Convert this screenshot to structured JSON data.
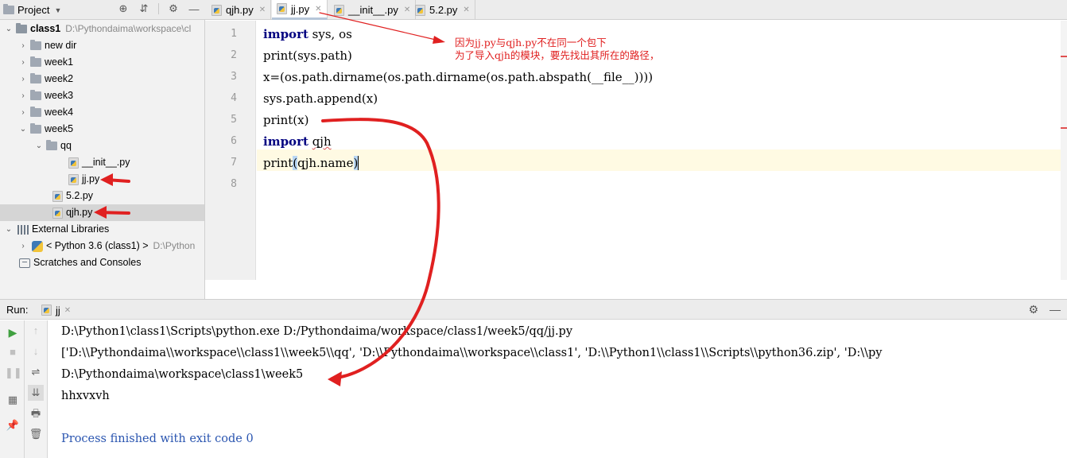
{
  "project_panel": {
    "title": "Project",
    "tools": [
      "target-icon",
      "collapse-icon",
      "gear-icon",
      "minimize-icon"
    ],
    "tree": {
      "root_name": "class1",
      "root_path": "D:\\Pythondaima\\workspace\\cl",
      "new_dir": "new dir",
      "week1": "week1",
      "week2": "week2",
      "week3": "week3",
      "week4": "week4",
      "week5": "week5",
      "qq": "qq",
      "init_file": "__init__.py",
      "jj_file": "jj.py",
      "file_52": "5.2.py",
      "qjh_file": "qjh.py",
      "external_libraries": "External Libraries",
      "python_sdk": "< Python 3.6 (class1) >",
      "python_sdk_path": "D:\\Python",
      "scratches": "Scratches and Consoles"
    }
  },
  "editor": {
    "tabs": [
      {
        "label": "qjh.py",
        "active": false
      },
      {
        "label": "jj.py",
        "active": true
      },
      {
        "label": "__init__.py",
        "active": false
      },
      {
        "label": "5.2.py",
        "active": false
      }
    ],
    "line_numbers": [
      "1",
      "2",
      "3",
      "4",
      "5",
      "6",
      "7",
      "8"
    ],
    "code": {
      "l1_kw": "import",
      "l1_rest": " sys, os",
      "l2": "print(sys.path)",
      "l3": "x=(os.path.dirname(os.path.dirname(os.path.abspath(__file__))))",
      "l4": "sys.path.append(x)",
      "l5": "print(x)",
      "l6_kw": "import",
      "l6_rest": "qjh",
      "l7_a": "print",
      "l7_b": "(",
      "l7_c": "qjh.name",
      "l7_d": ")"
    },
    "annotation": {
      "line1": "因为jj.py与qjh.py不在同一个包下",
      "line2": "为了导入qjh的模块，要先找出其所在的路径，"
    },
    "annotation_color": "#e02020"
  },
  "run_panel": {
    "title": "Run:",
    "tab_label": "jj",
    "tools": [
      "gear-icon",
      "minimize-icon"
    ],
    "console": [
      "D:\\Python1\\class1\\Scripts\\python.exe D:/Pythondaima/workspace/class1/week5/qq/jj.py",
      "['D:\\\\Pythondaima\\\\workspace\\\\class1\\\\week5\\\\qq', 'D:\\\\Pythondaima\\\\workspace\\\\class1', 'D:\\\\Python1\\\\class1\\\\Scripts\\\\python36.zip', 'D:\\\\py",
      "D:\\Pythondaima\\workspace\\class1\\week5",
      "hhxvxvh",
      "",
      "Process finished with exit code 0"
    ]
  }
}
